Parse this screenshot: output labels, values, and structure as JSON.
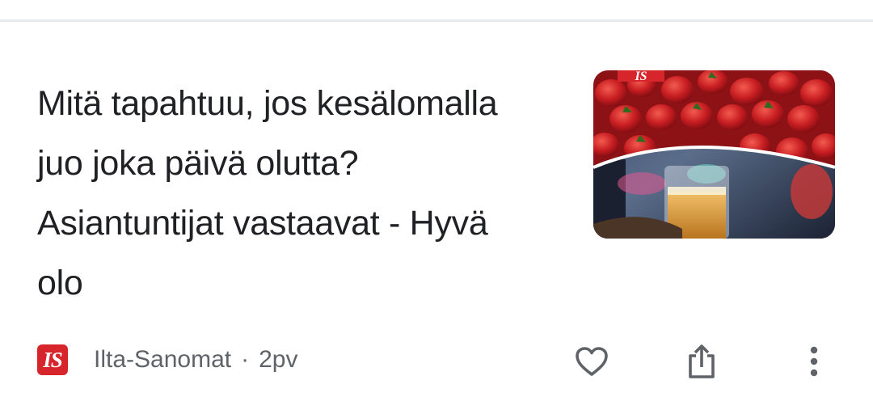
{
  "article": {
    "headline": "Mitä tapahtuu, jos kesälomalla juo joka päivä olutta? Asiantuntijat vastaavat - Hyvä olo",
    "source": "Ilta-Sanomat",
    "separator": "·",
    "age": "2pv",
    "source_logo_text": "IS",
    "thumbnail_logo_text": "IS"
  },
  "icons": {
    "like": "heart-outline-icon",
    "share": "share-icon",
    "more": "more-vertical-icon"
  },
  "colors": {
    "brand_red": "#d7262b",
    "headline_text": "#202124",
    "meta_text": "#5f6368",
    "icon": "#5f6368"
  }
}
